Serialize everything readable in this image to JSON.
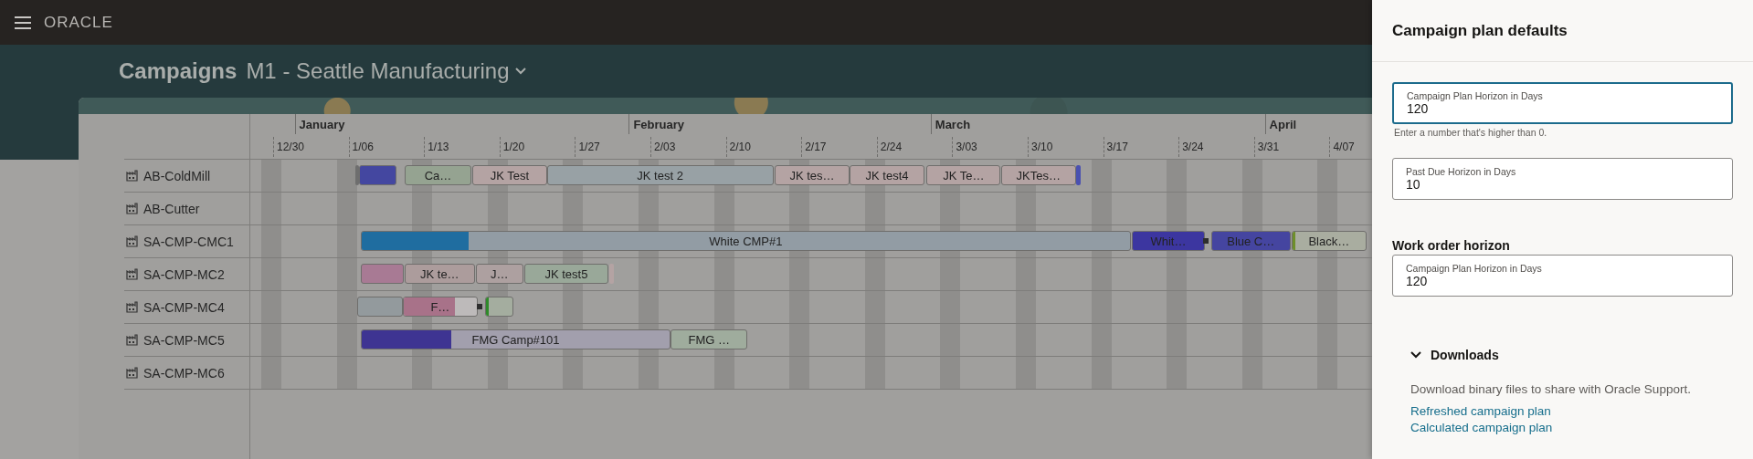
{
  "header": {
    "logo": "ORACLE"
  },
  "page": {
    "title": "Campaigns",
    "organization": "M1 - Seattle Manufacturing"
  },
  "gantt": {
    "months": [
      "January",
      "February",
      "March",
      "April"
    ],
    "weeks": [
      "12/30",
      "1/06",
      "1/13",
      "1/20",
      "1/27",
      "2/03",
      "2/10",
      "2/17",
      "2/24",
      "3/03",
      "3/10",
      "3/17",
      "3/24",
      "3/31",
      "4/07"
    ],
    "rows": [
      {
        "resource": "AB-ColdMill",
        "bars": [
          {
            "kind": "marker",
            "color": "#6e6e6e"
          },
          {
            "kind": "task",
            "color": "#4447a0"
          },
          {
            "kind": "task",
            "label": "Ca…",
            "color": "#95a391"
          },
          {
            "kind": "task",
            "label": "JK Test",
            "color": "#b4a3a3"
          },
          {
            "kind": "task",
            "label": "JK test 2",
            "color": "#98a1a5"
          },
          {
            "kind": "task",
            "label": "JK tes…",
            "color": "#b4a3a3"
          },
          {
            "kind": "task",
            "label": "JK test4",
            "color": "#b4a3a3"
          },
          {
            "kind": "task",
            "label": "JK Te…",
            "color": "#b4a3a3"
          },
          {
            "kind": "task",
            "label": "JKTes…",
            "color": "#b4a3a3"
          },
          {
            "kind": "marker",
            "color": "#4a50b0"
          }
        ]
      },
      {
        "resource": "AB-Cutter",
        "bars": []
      },
      {
        "resource": "SA-CMP-CMC1",
        "bars": [
          {
            "kind": "task",
            "label": "White CMP#1",
            "color": "#929ca4",
            "level": 0.14
          },
          {
            "kind": "task",
            "label": "Whit…",
            "color": "#3c36a0"
          },
          {
            "kind": "task",
            "label": "Blue C…",
            "color": "#4545a0"
          },
          {
            "kind": "task",
            "label": "Black…",
            "color": "#a9ada0"
          }
        ]
      },
      {
        "resource": "SA-CMP-MC2",
        "bars": [
          {
            "kind": "task",
            "color": "#a87a94"
          },
          {
            "kind": "task",
            "label": "JK te…",
            "color": "#ac9c9c"
          },
          {
            "kind": "task",
            "label": "J…",
            "color": "#ada0a0"
          },
          {
            "kind": "task",
            "label": "JK test5",
            "color": "#99a899"
          },
          {
            "kind": "marker",
            "color": "#b4a3a3"
          }
        ]
      },
      {
        "resource": "SA-CMP-MC4",
        "bars": [
          {
            "kind": "task",
            "color": "#939a9d"
          },
          {
            "kind": "task",
            "label": "F…",
            "color": "#bdbaba",
            "level": 0.7
          },
          {
            "kind": "task",
            "color": "#a4ad9f"
          }
        ]
      },
      {
        "resource": "SA-CMP-MC5",
        "bars": [
          {
            "kind": "task",
            "label": "FMG Camp#101",
            "color": "#a29fad",
            "level": 0.29
          },
          {
            "kind": "task",
            "label": "FMG …",
            "color": "#9fac9d"
          }
        ]
      },
      {
        "resource": "SA-CMP-MC6",
        "bars": []
      }
    ]
  },
  "panel": {
    "title": "Campaign plan defaults",
    "fields": [
      {
        "label": "Campaign Plan Horizon in Days",
        "value": "120",
        "focused": true,
        "help": "Enter a number that's higher than 0."
      },
      {
        "label": "Past Due Horizon in Days",
        "value": "10",
        "focused": false
      }
    ],
    "work_order": {
      "heading": "Work order horizon",
      "fields": [
        {
          "label": "Campaign Plan Horizon in Days",
          "value": "120",
          "focused": false
        }
      ]
    },
    "downloads": {
      "title": "Downloads",
      "expanded": true,
      "text": "Download binary files to share with Oracle Support.",
      "links": [
        "Refreshed campaign plan",
        "Calculated campaign plan"
      ]
    }
  }
}
